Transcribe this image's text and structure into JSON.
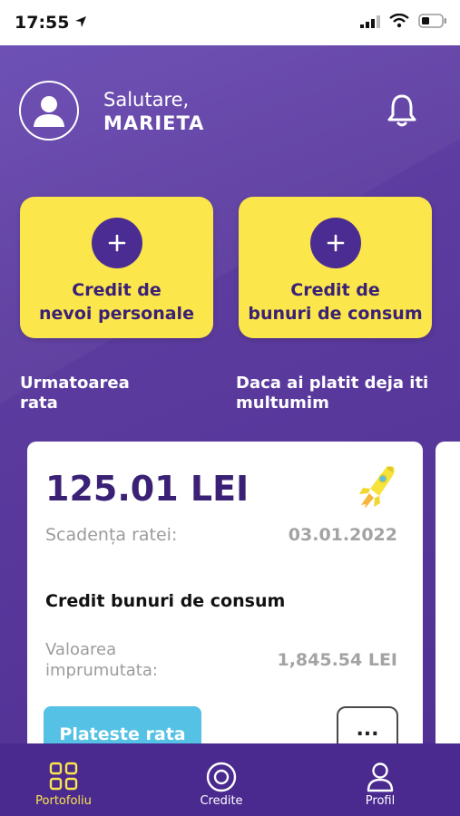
{
  "status_bar": {
    "time": "17:55"
  },
  "header": {
    "greeting": "Salutare,",
    "user_name": "MARIETA"
  },
  "quick_actions": [
    {
      "label_line1": "Credit de",
      "label_line2": "nevoi personale"
    },
    {
      "label_line1": "Credit de",
      "label_line2": "bunuri de consum"
    }
  ],
  "info": {
    "next_rate_line1": "Urmatoarea",
    "next_rate_line2": "rata",
    "thanks_line1": "Daca ai platit deja iti",
    "thanks_line2": "multumim"
  },
  "card": {
    "amount": "125.01 LEI",
    "due_label": "Scadența ratei:",
    "due_date": "03.01.2022",
    "credit_type": "Credit bunuri de consum",
    "loan_label_line1": "Valoarea",
    "loan_label_line2": "imprumutata:",
    "loan_value": "1,845.54 LEI",
    "pay_button": "Plateste rata",
    "more_button": "..."
  },
  "bottom_nav": [
    {
      "label": "Portofoliu",
      "icon": "grid-icon",
      "active": true
    },
    {
      "label": "Credite",
      "icon": "target-icon",
      "active": false
    },
    {
      "label": "Profil",
      "icon": "user-icon",
      "active": false
    }
  ],
  "colors": {
    "background": "#5b3a9e",
    "tile": "#fbe64b",
    "accent_dark": "#3b2176",
    "pay_button": "#54c1e5",
    "nav_active": "#fbe64b"
  }
}
